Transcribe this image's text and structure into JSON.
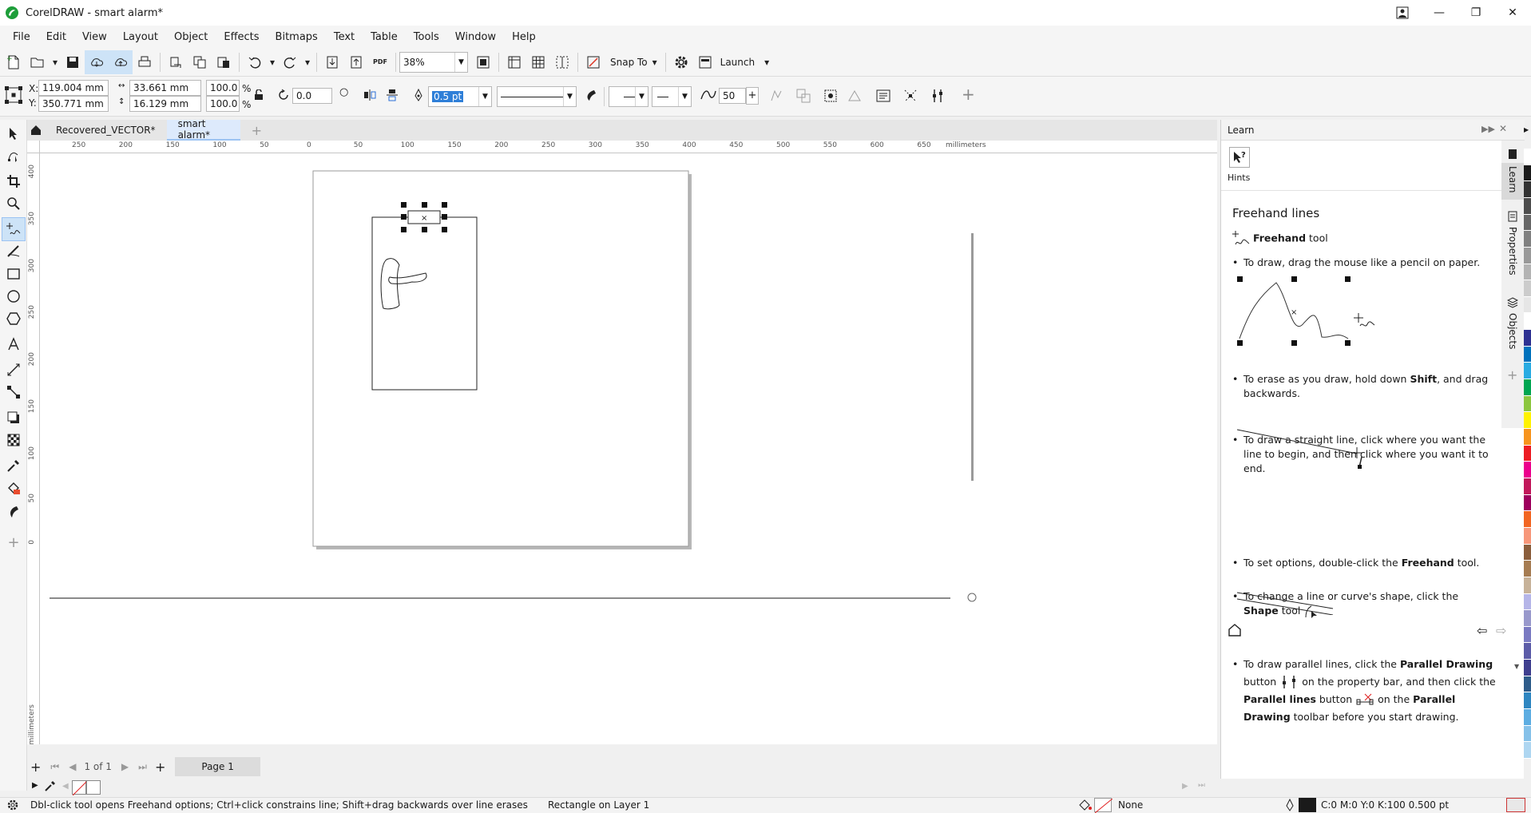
{
  "window": {
    "title": "CorelDRAW - smart alarm*"
  },
  "menu": [
    "File",
    "Edit",
    "View",
    "Layout",
    "Object",
    "Effects",
    "Bitmaps",
    "Text",
    "Table",
    "Tools",
    "Window",
    "Help"
  ],
  "toolbar": {
    "zoom": "38%",
    "snap_to": "Snap To",
    "launch": "Launch"
  },
  "propbar": {
    "x_label": "X:",
    "x": "119.004 mm",
    "y_label": "Y:",
    "y": "350.771 mm",
    "w": "33.661 mm",
    "h": "16.129 mm",
    "sx": "100.0",
    "sy": "100.0",
    "pct": "%",
    "rotation": "0.0",
    "outline_width": "0.5 pt",
    "smoothing": "50"
  },
  "tabs": [
    "Recovered_VECTOR*",
    "smart alarm*"
  ],
  "ruler": {
    "unit": "millimeters",
    "h_ticks": [
      "250",
      "200",
      "150",
      "100",
      "50",
      "0",
      "50",
      "100",
      "150",
      "200",
      "250",
      "300",
      "350",
      "400",
      "450",
      "500",
      "550",
      "600",
      "650"
    ],
    "v_ticks": [
      "400",
      "350",
      "300",
      "250",
      "200",
      "150",
      "100",
      "50",
      "0"
    ]
  },
  "pagenav": {
    "position": "1 of 1",
    "page_tab": "Page 1"
  },
  "status": {
    "hint": "Dbl-click tool opens Freehand options; Ctrl+click constrains line; Shift+drag backwards over line erases",
    "object": "Rectangle on Layer 1",
    "fill": "None",
    "outline": "C:0 M:0 Y:0 K:100  0.500 pt"
  },
  "docker": {
    "title": "Learn",
    "hints_label": "Hints",
    "heading": "Freehand lines",
    "tool_name": "Freehand",
    "tool_word": "tool",
    "b1": "To draw, drag the mouse like a pencil on paper.",
    "b2_pre": "To erase as you draw, hold down ",
    "b2_key": "Shift",
    "b2_post": ", and drag backwards.",
    "b3": "To draw a straight line, click where you want the line to begin, and then click where you want it to end.",
    "b4_pre": "To set options, double-click the ",
    "b4_key": "Freehand",
    "b4_post": " tool.",
    "b5_pre": "To change a line or curve's shape, click the ",
    "b5_key": "Shape",
    "b5_post": " tool",
    "b6_a": "To draw parallel lines, click the ",
    "b6_b": "Parallel Drawing",
    "b6_c": " button",
    "b6_d": " on the property bar, and then click the ",
    "b6_e": "Parallel lines",
    "b6_f": " button",
    "b6_g": " on the ",
    "b6_h": "Parallel Drawing",
    "b6_i": " toolbar before you start drawing.",
    "side_tabs": [
      "Learn",
      "Properties",
      "Objects"
    ]
  },
  "palette": [
    "#ffffff",
    "#1a1a1a",
    "#333333",
    "#4d4d4d",
    "#666666",
    "#808080",
    "#999999",
    "#b3b3b3",
    "#cccccc",
    "#e6e6e6",
    "#ffffff",
    "#2e3192",
    "#0071bc",
    "#29abe2",
    "#00a651",
    "#8cc63f",
    "#fff200",
    "#f7941d",
    "#ed1c24",
    "#ec008c",
    "#c2185b",
    "#9e005d",
    "#f26522",
    "#f7977a",
    "#8b5e3c",
    "#a67c52",
    "#c7b299",
    "#b5b5e8",
    "#9999cc",
    "#7a7ac2",
    "#5c5ca8",
    "#3f3f8f",
    "#2e5c8a",
    "#2e86c1",
    "#5dade2",
    "#85c1e9",
    "#aed6f1"
  ]
}
